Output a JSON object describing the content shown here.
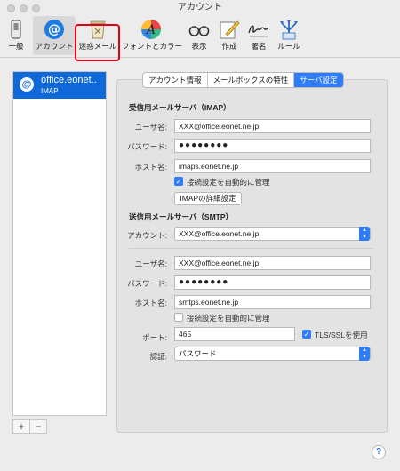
{
  "window": {
    "title": "アカウント"
  },
  "toolbar": {
    "items": [
      {
        "label": "一般",
        "icon": "general-switch-icon"
      },
      {
        "label": "アカウント",
        "icon": "at-sign-icon"
      },
      {
        "label": "迷惑メール",
        "icon": "junk-trash-icon"
      },
      {
        "label": "フォントとカラー",
        "icon": "font-color-icon"
      },
      {
        "label": "表示",
        "icon": "glasses-icon"
      },
      {
        "label": "作成",
        "icon": "compose-pencil-icon"
      },
      {
        "label": "署名",
        "icon": "signature-icon"
      },
      {
        "label": "ルール",
        "icon": "rules-icon"
      }
    ],
    "selected": "アカウント",
    "highlighted": "迷惑メール",
    "highlight_color": "#e0001a"
  },
  "accounts": {
    "items": [
      {
        "name": "office.eonet..",
        "type": "IMAP"
      }
    ],
    "add_label": "+",
    "remove_label": "−"
  },
  "tabs": {
    "items": [
      "アカウント情報",
      "メールボックスの特性",
      "サーバ設定"
    ],
    "active": "サーバ設定"
  },
  "incoming": {
    "heading": "受信用メールサーバ（IMAP）",
    "user_label": "ユーザ名:",
    "user_value": "XXX@office.eonet.ne.jp",
    "password_label": "パスワード:",
    "password_value": "●●●●●●●●",
    "host_label": "ホスト名:",
    "host_value": "imaps.eonet.ne.jp",
    "auto_manage_label": "接続設定を自動的に管理",
    "auto_manage_checked": true,
    "advanced_button": "IMAPの詳細設定"
  },
  "outgoing": {
    "heading": "送信用メールサーバ（SMTP）",
    "account_label": "アカウント:",
    "account_value": "XXX@office.eonet.ne.jp",
    "user_label": "ユーザ名:",
    "user_value": "XXX@office.eonet.ne.jp",
    "password_label": "パスワード:",
    "password_value": "●●●●●●●●",
    "host_label": "ホスト名:",
    "host_value": "smtps.eonet.ne.jp",
    "auto_manage_label": "接続設定を自動的に管理",
    "auto_manage_checked": false,
    "port_label": "ポート:",
    "port_value": "465",
    "tls_label": "TLS/SSLを使用",
    "tls_checked": true,
    "auth_label": "認証:",
    "auth_value": "パスワード"
  },
  "help": {
    "label": "?"
  },
  "colors": {
    "accent": "#2f7df6",
    "selection": "#1069d8"
  }
}
